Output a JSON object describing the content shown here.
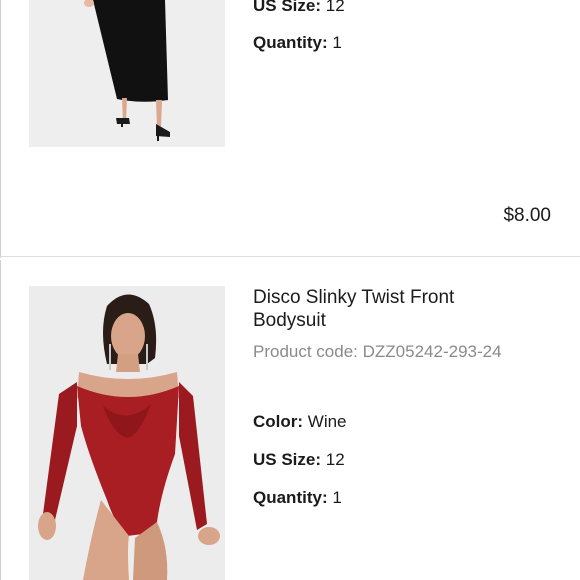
{
  "item1": {
    "size_label": "US Size:",
    "size_value": "12",
    "quantity_label": "Quantity:",
    "quantity_value": "1",
    "price": "$8.00",
    "image_icon": "black-maxi-skirt-photo"
  },
  "item2": {
    "title": "Disco Slinky Twist Front Bodysuit",
    "product_code_label": "Product code:",
    "product_code_value": "DZZ05242-293-24",
    "color_label": "Color:",
    "color_value": "Wine",
    "size_label": "US Size:",
    "size_value": "12",
    "quantity_label": "Quantity:",
    "quantity_value": "1",
    "image_icon": "wine-bodysuit-photo"
  },
  "colors": {
    "text": "#1b1b1b",
    "muted": "#8a8a8a",
    "divider": "#dedede",
    "garment_black": "#111111",
    "garment_wine": "#a81e22"
  }
}
